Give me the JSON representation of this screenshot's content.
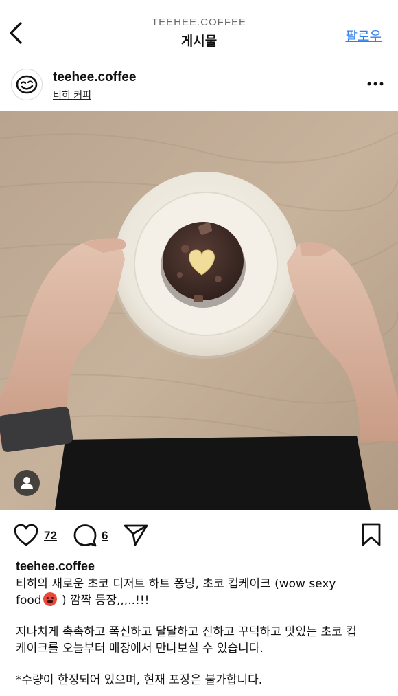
{
  "topbar": {
    "account_caps": "TEEHEE.COFFEE",
    "page_title": "게시물",
    "follow_label": "팔로우"
  },
  "post": {
    "username": "teehee.coffee",
    "location": "티히 커피",
    "likes": "72",
    "comments": "6"
  },
  "caption": {
    "username": "teehee.coffee",
    "line1": "티히의 새로운 초코 디저트 하트 퐁당, 초코 컵케이크 (wow sexy",
    "line2_a": "food",
    "line2_b": " ) 깜짝 등장,,,..!!!",
    "para2_line1": "지나치게 촉촉하고 폭신하고 달달하고 진하고 꾸덕하고 맛있는 초코 컵",
    "para2_line2": "케이크를 오늘부터 매장에서 만나보실 수 있습니다.",
    "para3_line1": "*수량이 한정되어 있으며, 현재 포장은 불가합니다."
  },
  "icons": {
    "back": "chevron-left-icon",
    "more": "more-horizontal-icon",
    "like": "heart-icon",
    "comment": "comment-icon",
    "share": "send-icon",
    "save": "bookmark-icon",
    "tag": "user-tag-icon",
    "emoji": "hot-face-emoji"
  },
  "colors": {
    "accent": "#2f80ed",
    "text": "#111111",
    "muted": "#6b6b6b"
  }
}
